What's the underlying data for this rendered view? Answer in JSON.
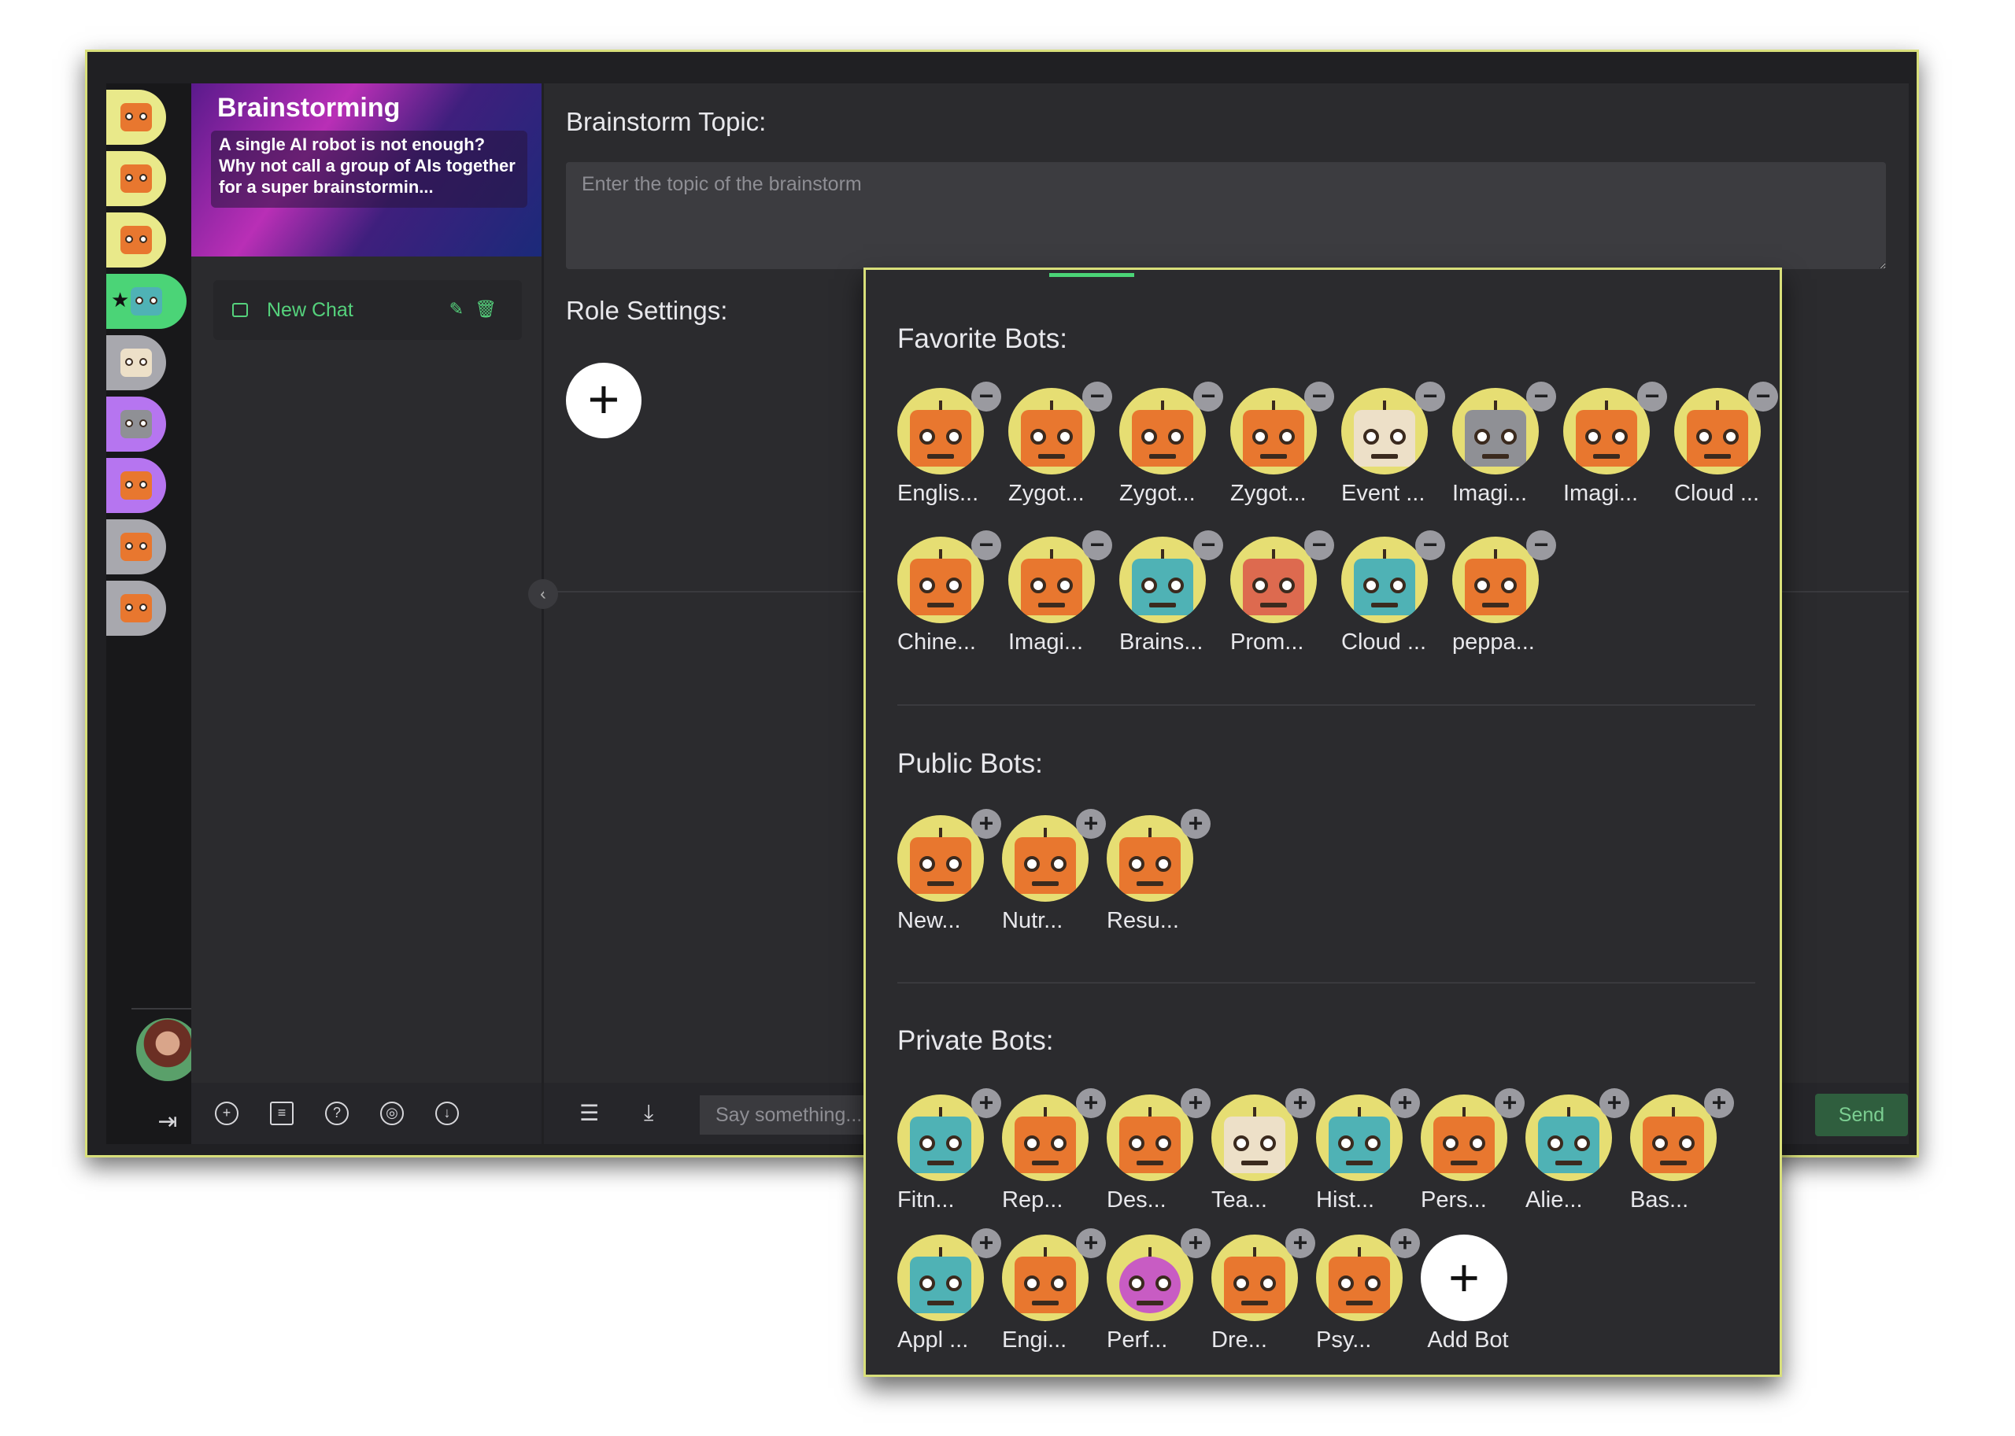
{
  "sidebar": {
    "bots": [
      {
        "color": "yellow",
        "face": "orange"
      },
      {
        "color": "yellow",
        "face": "orange"
      },
      {
        "color": "yellow",
        "face": "orange"
      },
      {
        "color": "green",
        "face": "teal",
        "active": true
      },
      {
        "color": "gray",
        "face": "cream"
      },
      {
        "color": "purple",
        "face": "gray"
      },
      {
        "color": "purple",
        "face": "orange"
      },
      {
        "color": "gray",
        "face": "orange"
      },
      {
        "color": "gray",
        "face": "orange"
      }
    ]
  },
  "chat_panel": {
    "banner_title": "Brainstorming",
    "banner_desc": "A single AI robot is not enough? Why not call a group of AIs together for a super brainstormin...",
    "chat_item": "New Chat"
  },
  "main": {
    "topic_label": "Brainstorm Topic:",
    "topic_placeholder": "Enter the topic of the brainstorm",
    "role_label": "Role Settings:",
    "say_placeholder": "Say something...",
    "send_label": "Send"
  },
  "popup": {
    "favorite_title": "Favorite Bots:",
    "public_title": "Public Bots:",
    "private_title": "Private Bots:",
    "favorite": [
      "Englis...",
      "Zygot...",
      "Zygot...",
      "Zygot...",
      "Event ...",
      "Imagi...",
      "Imagi...",
      "Cloud ...",
      "Chine...",
      "Imagi...",
      "Brains...",
      "Prom...",
      "Cloud ...",
      "peppa..."
    ],
    "favorite_faces": [
      "orange",
      "orange",
      "orange",
      "orange",
      "cream",
      "gray",
      "orange",
      "orange",
      "orange",
      "orange",
      "teal",
      "rose",
      "teal",
      "orange"
    ],
    "public": [
      "New...",
      "Nutr...",
      "Resu..."
    ],
    "public_faces": [
      "orange",
      "orange",
      "orange"
    ],
    "private": [
      "Fitn...",
      "Rep...",
      "Des...",
      "Tea...",
      "Hist...",
      "Pers...",
      "Alie...",
      "Bas...",
      "Appl ...",
      "Engi...",
      "Perf...",
      "Dre...",
      "Psy..."
    ],
    "private_faces": [
      "teal",
      "orange",
      "orange",
      "cream",
      "teal",
      "orange",
      "teal",
      "orange",
      "teal",
      "orange",
      "purple",
      "orange",
      "orange"
    ],
    "add_bot": "Add Bot",
    "remove_symbol": "−",
    "add_symbol": "+"
  }
}
